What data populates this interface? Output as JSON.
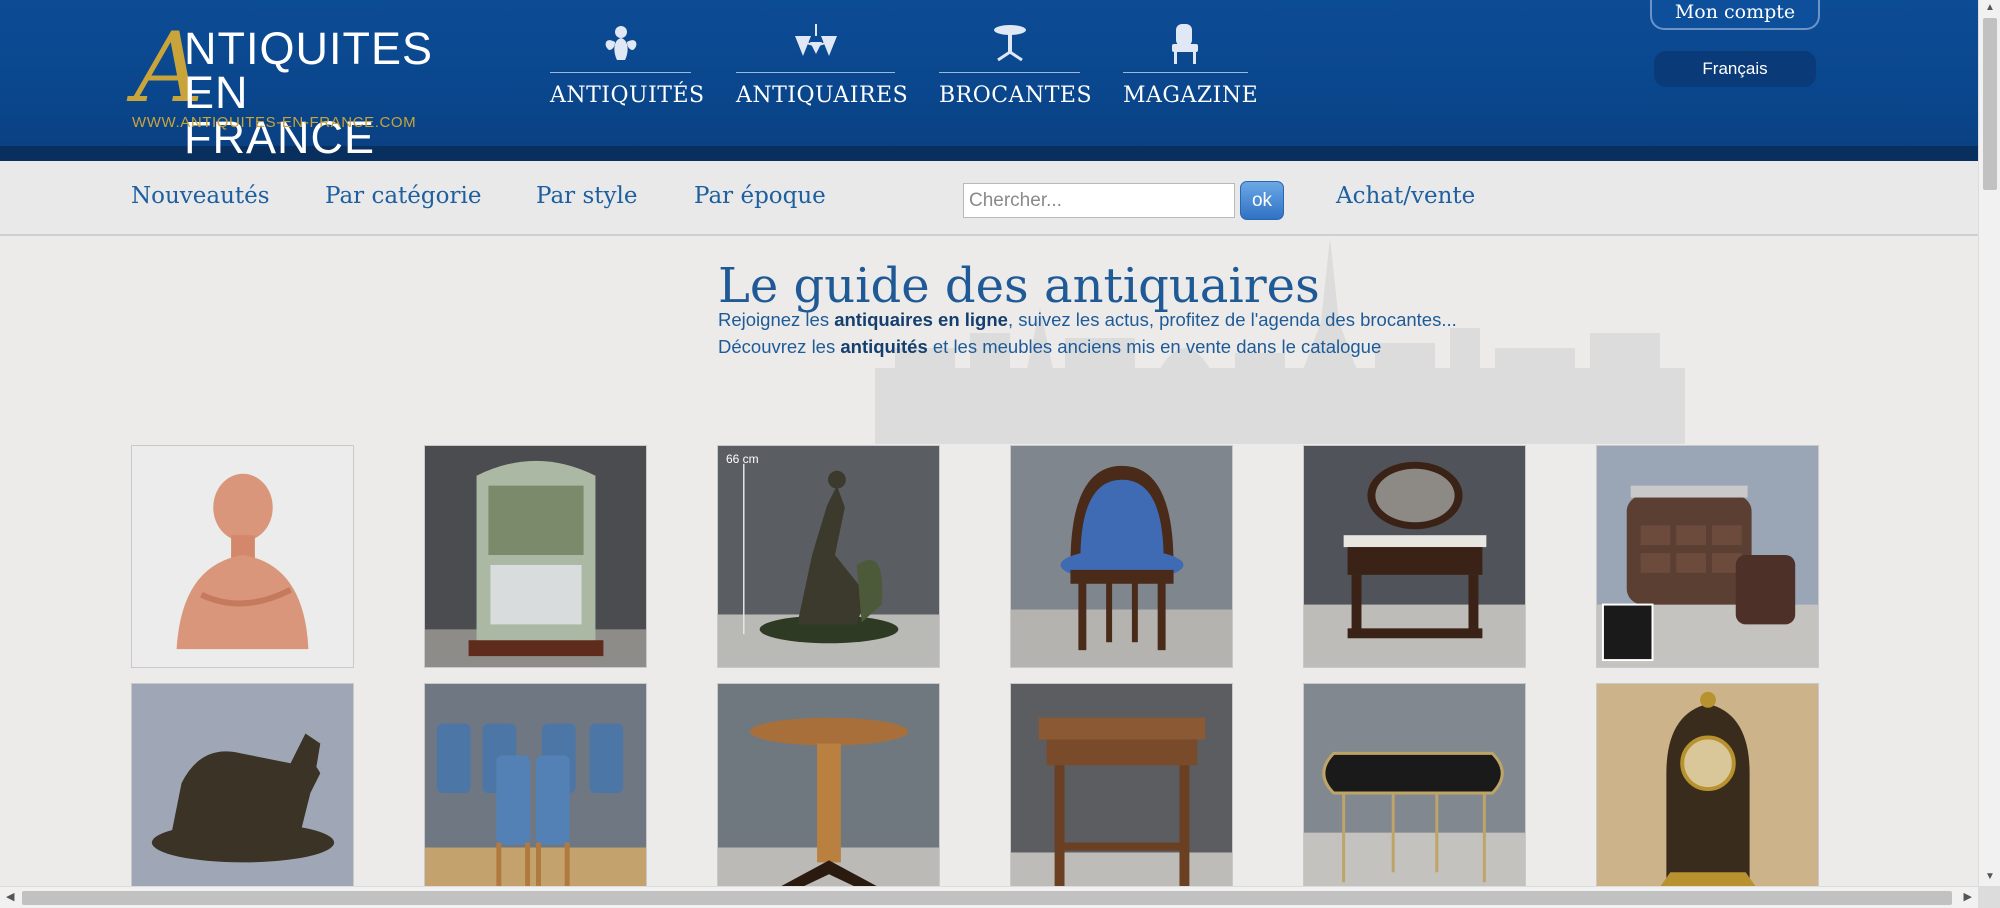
{
  "logo": {
    "initial": "A",
    "line1": "NTIQUITES",
    "line2": "EN FRANCE",
    "url": "WWW.ANTIQUITES-EN-FRANCE.COM"
  },
  "main_nav": [
    {
      "label": "ANTIQUITÉS",
      "icon": "cherub-icon"
    },
    {
      "label": "ANTIQUAIRES",
      "icon": "chandelier-icon"
    },
    {
      "label": "BROCANTES",
      "icon": "pedestal-table-icon"
    },
    {
      "label": "MAGAZINE",
      "icon": "armchair-icon"
    }
  ],
  "account": {
    "label": "Mon compte"
  },
  "language": {
    "label": "Français"
  },
  "subnav": {
    "links": [
      "Nouveautés",
      "Par catégorie",
      "Par style",
      "Par époque"
    ],
    "search_placeholder": "Chercher...",
    "search_button": "ok",
    "buy_sell": "Achat/vente"
  },
  "hero": {
    "title": "Le guide des antiquaires",
    "line1_pre": "Rejoignez les ",
    "line1_bold": "antiquaires en ligne",
    "line1_post": ", suivez les actus, profitez de l'agenda des brocantes...",
    "line2_pre": "Découvrez les ",
    "line2_bold": "antiquités",
    "line2_post": " et les meubles anciens mis en vente dans le catalogue"
  },
  "gallery": {
    "measure_label": "66 cm",
    "items": [
      {
        "subject": "terracotta bust",
        "bg": "#ececec",
        "fg": "#d9967a"
      },
      {
        "subject": "painted trumeau mirror",
        "bg": "#4a4c4f",
        "fg": "#aab8a4"
      },
      {
        "subject": "bronze sculpture",
        "bg": "#5a5d62",
        "fg": "#3b3a2c"
      },
      {
        "subject": "blue bergere chair",
        "bg": "#7f868d",
        "fg": "#3f6bb5"
      },
      {
        "subject": "dressing table with mirror",
        "bg": "#50535a",
        "fg": "#3a2216"
      },
      {
        "subject": "art deco cabinet and pouf",
        "bg": "#9aa5b6",
        "fg": "#5a3f32"
      },
      {
        "subject": "bronze dog sculpture",
        "bg": "#9fa7b7",
        "fg": "#3a3326"
      },
      {
        "subject": "six blue chairs",
        "bg": "#6f7783",
        "fg": "#4c76a6"
      },
      {
        "subject": "pedestal table",
        "bg": "#70787f",
        "fg": "#a86f3b"
      },
      {
        "subject": "burl wood table",
        "bg": "#5b5d60",
        "fg": "#8b5a34"
      },
      {
        "subject": "nesting tables",
        "bg": "#828890",
        "fg": "#bea466"
      },
      {
        "subject": "boulle cartel clock",
        "bg": "#cdb389",
        "fg": "#3a2c1c"
      }
    ]
  },
  "colors": {
    "header_blue": "#0c4c95",
    "gold": "#c9a43a",
    "link_blue": "#1d5fa0"
  }
}
